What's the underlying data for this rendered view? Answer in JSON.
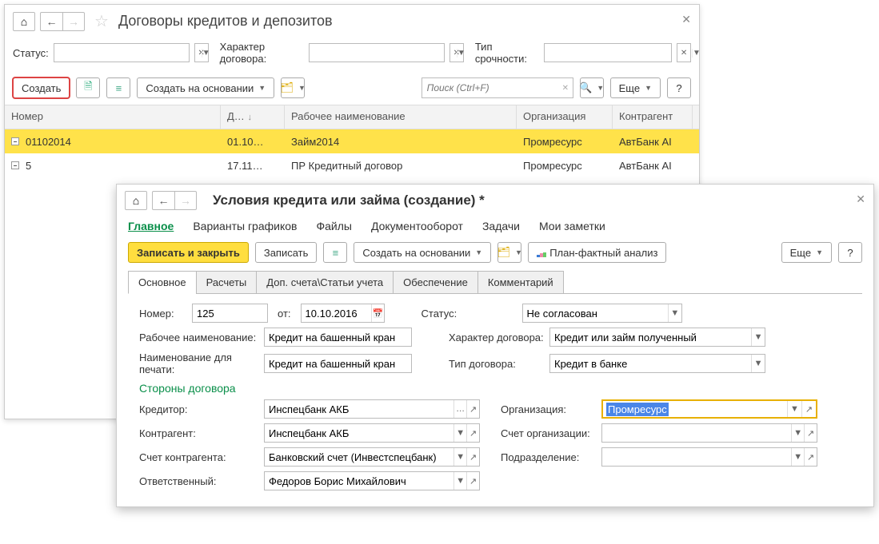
{
  "win1": {
    "title": "Договоры кредитов и депозитов",
    "filters": {
      "status_label": "Статус:",
      "char_label": "Характер договора:",
      "term_label": "Тип срочности:"
    },
    "toolbar": {
      "create": "Создать",
      "create_basis": "Создать на основании",
      "search_placeholder": "Поиск (Ctrl+F)",
      "more": "Еще",
      "help": "?"
    },
    "grid": {
      "headers": {
        "num": "Номер",
        "date": "Д…",
        "name": "Рабочее наименование",
        "org": "Организация",
        "agent": "Контрагент"
      },
      "rows": [
        {
          "num": "01102014",
          "date": "01.10…",
          "name": "Займ2014",
          "org": "Промресурс",
          "agent": "АвтБанк АІ"
        },
        {
          "num": "5",
          "date": "17.11…",
          "name": "ПР Кредитный договор",
          "org": "Промресурс",
          "agent": "АвтБанк АІ"
        }
      ]
    }
  },
  "win2": {
    "title": "Условия кредита или займа (создание) *",
    "tabs": {
      "main": "Главное",
      "variants": "Варианты графиков",
      "files": "Файлы",
      "docflow": "Документооборот",
      "tasks": "Задачи",
      "notes": "Мои заметки"
    },
    "toolbar": {
      "save_close": "Записать и закрыть",
      "save": "Записать",
      "basis": "Создать на основании",
      "plan": "План-фактный анализ",
      "more": "Еще",
      "help": "?"
    },
    "subtabs": {
      "basic": "Основное",
      "calc": "Расчеты",
      "accounts": "Доп. счета\\Статьи учета",
      "collateral": "Обеспечение",
      "comment": "Комментарий"
    },
    "form": {
      "num_label": "Номер:",
      "num_value": "125",
      "from_label": "от:",
      "date_value": "10.10.2016",
      "status_label": "Статус:",
      "status_value": "Не согласован",
      "work_name_label": "Рабочее наименование:",
      "work_name_value": "Кредит на башенный кран",
      "char_label": "Характер договора:",
      "char_value": "Кредит или займ полученный",
      "print_name_label": "Наименование для печати:",
      "print_name_value": "Кредит на башенный кран",
      "type_label": "Тип договора:",
      "type_value": "Кредит в банке",
      "section_parties": "Стороны договора",
      "creditor_label": "Кредитор:",
      "creditor_value": "Инспецбанк АКБ",
      "org_label": "Организация:",
      "org_value": "Промресурс",
      "counterparty_label": "Контрагент:",
      "counterparty_value": "Инспецбанк АКБ",
      "org_account_label": "Счет организации:",
      "org_account_value": "",
      "counter_account_label": "Счет контрагента:",
      "counter_account_value": "Банковский счет (Инвестспецбанк)",
      "dept_label": "Подразделение:",
      "dept_value": "",
      "responsible_label": "Ответственный:",
      "responsible_value": "Федоров Борис Михайлович"
    }
  }
}
